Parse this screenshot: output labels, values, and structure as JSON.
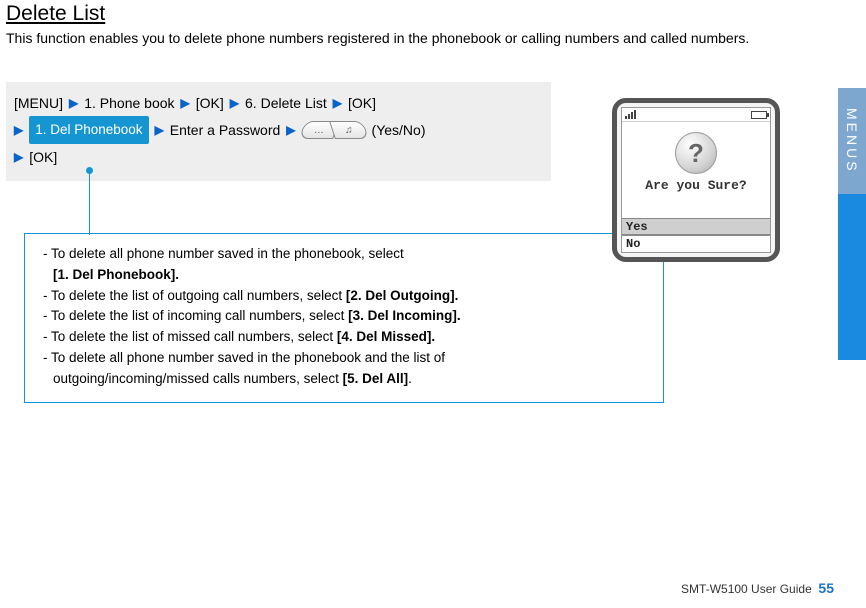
{
  "title": "Delete List",
  "intro": "This function enables you to delete phone numbers registered in the phonebook or calling numbers and called numbers.",
  "nav": {
    "menu": "[MENU]",
    "step1": "1. Phone book",
    "ok1": "[OK]",
    "step2": "6. Delete List",
    "ok2": "[OK]",
    "pill": "1. Del Phonebook",
    "enter_pw": "Enter a Password",
    "yesno": "(Yes/No)",
    "ok3": "[OK]"
  },
  "options": {
    "l1a": "- To delete all phone number saved in the phonebook, select",
    "l1b": "[1. Del Phonebook].",
    "l2a": "- To delete the list of outgoing call numbers, select ",
    "l2b": "[2. Del Outgoing].",
    "l3a": "- To delete the list of incoming call numbers, select ",
    "l3b": "[3. Del Incoming].",
    "l4a": "- To delete the list of missed call numbers, select ",
    "l4b": "[4. Del Missed].",
    "l5a": "- To delete all phone number saved in the phonebook and the list of",
    "l5b": "outgoing/incoming/missed calls numbers, select ",
    "l5c": "[5. Del All]"
  },
  "phone": {
    "prompt": "Are you Sure?",
    "yes": "Yes",
    "no": "No",
    "qmark": "?"
  },
  "side_label": "MENUS",
  "footer": {
    "text": "SMT-W5100 User Guide",
    "page": "55"
  },
  "key": {
    "left_dots": "…",
    "right_note": "♫"
  }
}
